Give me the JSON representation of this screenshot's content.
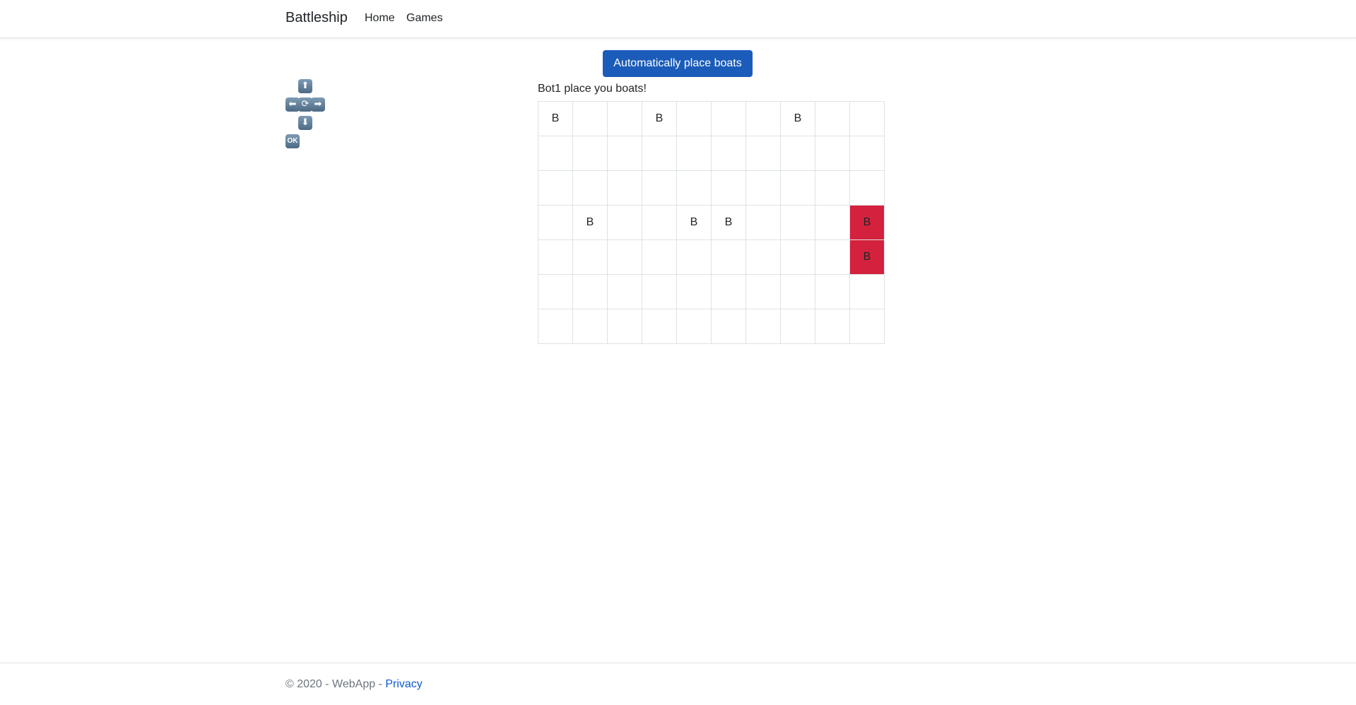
{
  "navbar": {
    "brand": "Battleship",
    "links": [
      "Home",
      "Games"
    ]
  },
  "toolbar": {
    "auto_place_label": "Automatically place boats"
  },
  "controls": {
    "up": "⬆",
    "left": "⬅",
    "rotate": "⟳",
    "right": "➡",
    "down": "⬇",
    "ok": "OK"
  },
  "board": {
    "prompt": "Bot1 place you boats!",
    "rows": [
      [
        "B",
        "",
        "",
        "B",
        "",
        "",
        "",
        "B",
        "",
        ""
      ],
      [
        "",
        "",
        "",
        "",
        "",
        "",
        "",
        "",
        "",
        ""
      ],
      [
        "",
        "",
        "",
        "",
        "",
        "",
        "",
        "",
        "",
        ""
      ],
      [
        "",
        "B",
        "",
        "",
        "B",
        "B",
        "",
        "",
        "",
        "B"
      ],
      [
        "",
        "",
        "",
        "",
        "",
        "",
        "",
        "",
        "",
        "B"
      ],
      [
        "",
        "",
        "",
        "",
        "",
        "",
        "",
        "",
        "",
        ""
      ],
      [
        "",
        "",
        "",
        "",
        "",
        "",
        "",
        "",
        "",
        ""
      ]
    ],
    "selected_cells": [
      [
        3,
        9
      ],
      [
        4,
        9
      ]
    ],
    "selected_color": "#d4213d"
  },
  "footer": {
    "text": "© 2020 - WebApp - ",
    "privacy_label": "Privacy"
  }
}
